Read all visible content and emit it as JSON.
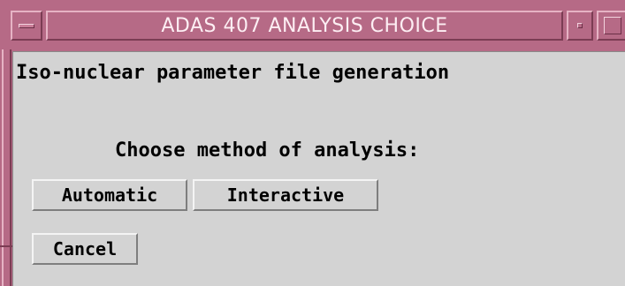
{
  "window": {
    "title": "ADAS 407 ANALYSIS CHOICE",
    "frame_color": "#b66a86",
    "title_color": "#fdeef3",
    "background_color": "#d3d3d3"
  },
  "titlebar": {
    "menu_icon": "window-menu-icon",
    "minimize_icon": "minimize-icon",
    "maximize_icon": "maximize-icon"
  },
  "content": {
    "heading": "Iso-nuclear parameter file generation",
    "prompt": "Choose method of analysis:"
  },
  "buttons": {
    "automatic": "Automatic",
    "interactive": "Interactive",
    "cancel": "Cancel"
  }
}
